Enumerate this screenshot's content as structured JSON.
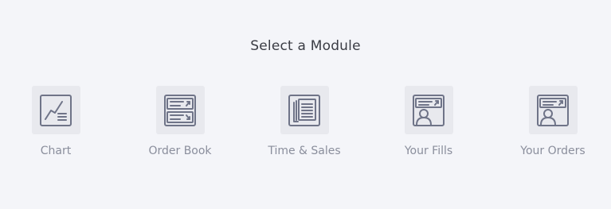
{
  "title": "Select a Module",
  "colors": {
    "background": "#f4f5f9",
    "tile": "#e8e9ee",
    "icon_stroke": "#6f7488",
    "label": "#8a8e9c",
    "title": "#3a3c44"
  },
  "modules": [
    {
      "label": "Chart",
      "icon": "chart-icon"
    },
    {
      "label": "Order Book",
      "icon": "order-book-icon"
    },
    {
      "label": "Time & Sales",
      "icon": "time-and-sales-icon"
    },
    {
      "label": "Your Fills",
      "icon": "your-fills-icon"
    },
    {
      "label": "Your Orders",
      "icon": "your-orders-icon"
    }
  ]
}
